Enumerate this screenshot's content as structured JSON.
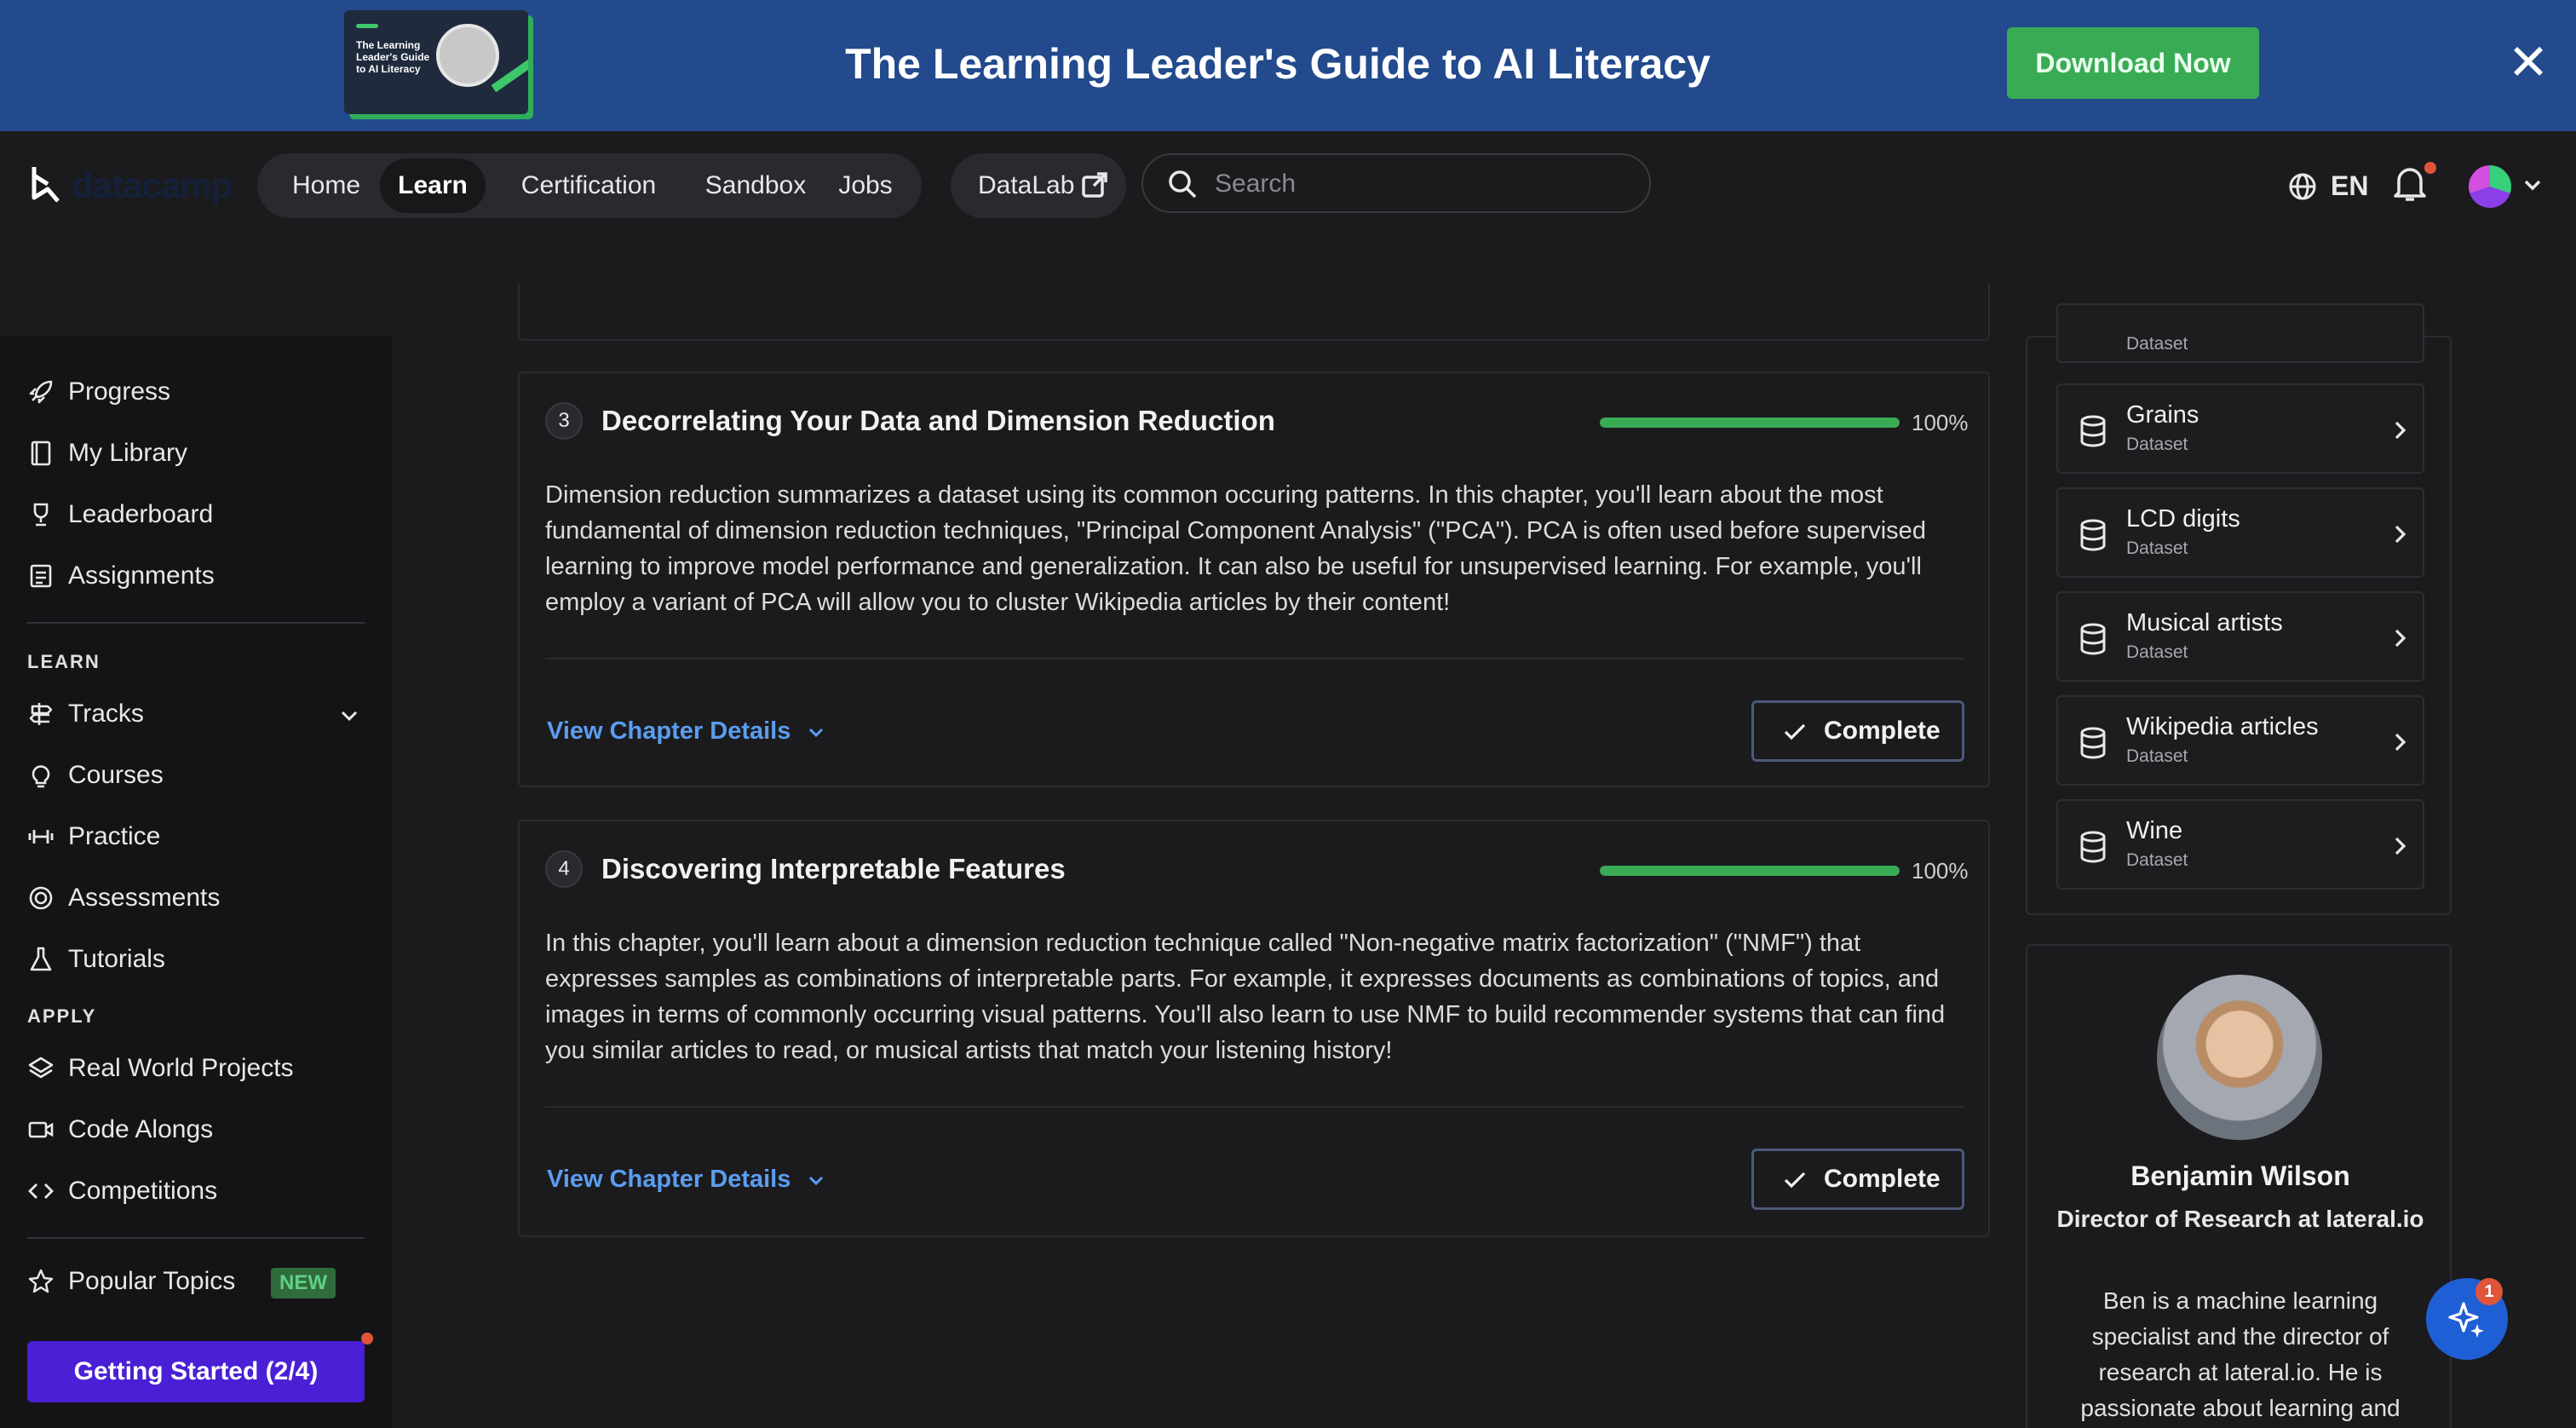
{
  "banner": {
    "thumb_text": "The Learning Leader's Guide to AI Literacy",
    "title": "The Learning Leader's Guide to AI Literacy",
    "cta": "Download Now",
    "close": "✕"
  },
  "nav": {
    "logo": "datacamp",
    "items": [
      {
        "label": "Home"
      },
      {
        "label": "Learn"
      },
      {
        "label": "Certification"
      },
      {
        "label": "Sandbox"
      },
      {
        "label": "Jobs"
      }
    ],
    "active": "Learn",
    "datalab": "DataLab",
    "search_placeholder": "Search",
    "language": "EN"
  },
  "sidebar": {
    "top_items": [
      {
        "label": "Progress",
        "icon": "rocket-icon"
      },
      {
        "label": "My Library",
        "icon": "book-icon"
      },
      {
        "label": "Leaderboard",
        "icon": "trophy-icon"
      },
      {
        "label": "Assignments",
        "icon": "clipboard-icon"
      }
    ],
    "learn_heading": "LEARN",
    "learn_items": [
      {
        "label": "Tracks",
        "icon": "signpost-icon"
      },
      {
        "label": "Courses",
        "icon": "lightbulb-icon"
      },
      {
        "label": "Practice",
        "icon": "dumbbell-icon"
      },
      {
        "label": "Assessments",
        "icon": "target-icon"
      },
      {
        "label": "Tutorials",
        "icon": "flask-icon"
      }
    ],
    "apply_heading": "APPLY",
    "apply_items": [
      {
        "label": "Real World Projects",
        "icon": "layers-icon"
      },
      {
        "label": "Code Alongs",
        "icon": "video-icon"
      },
      {
        "label": "Competitions",
        "icon": "code-icon"
      }
    ],
    "popular_topics": "Popular Topics",
    "new_badge": "NEW",
    "getting_started": "Getting Started (2/4)"
  },
  "chapters": [
    {
      "number": "3",
      "title": "Decorrelating Your Data and Dimension Reduction",
      "progress_percent": 100,
      "progress_label": "100%",
      "description": "Dimension reduction summarizes a dataset using its common occuring patterns. In this chapter, you'll learn about the most fundamental of dimension reduction techniques, \"Principal Component Analysis\" (\"PCA\"). PCA is often used before supervised learning to improve model performance and generalization. It can also be useful for unsupervised learning. For example, you'll employ a variant of PCA will allow you to cluster Wikipedia articles by their content!",
      "details_label": "View Chapter Details",
      "status_label": "Complete"
    },
    {
      "number": "4",
      "title": "Discovering Interpretable Features",
      "progress_percent": 100,
      "progress_label": "100%",
      "description": "In this chapter, you'll learn about a dimension reduction technique called \"Non-negative matrix factorization\" (\"NMF\") that expresses samples as combinations of interpretable parts. For example, it expresses documents as combinations of topics, and images in terms of commonly occurring visual patterns. You'll also learn to use NMF to build recommender systems that can find you similar articles to read, or musical artists that match your listening history!",
      "details_label": "View Chapter Details",
      "status_label": "Complete"
    }
  ],
  "datasets": {
    "partial_subtitle": "Dataset",
    "items": [
      {
        "name": "Grains",
        "type": "Dataset"
      },
      {
        "name": "LCD digits",
        "type": "Dataset"
      },
      {
        "name": "Musical artists",
        "type": "Dataset"
      },
      {
        "name": "Wikipedia articles",
        "type": "Dataset"
      },
      {
        "name": "Wine",
        "type": "Dataset"
      }
    ]
  },
  "author": {
    "name": "Benjamin Wilson",
    "role": "Director of Research at lateral.io",
    "bio": "Ben is a machine learning specialist and the director of research at lateral.io. He is passionate about learning and"
  },
  "assistant": {
    "notification_count": "1"
  },
  "colors": {
    "banner_bg": "#224a8c",
    "cta_green": "#3aab55",
    "link_blue": "#5b9df0",
    "getting_started_purple": "#4a1fd6"
  }
}
